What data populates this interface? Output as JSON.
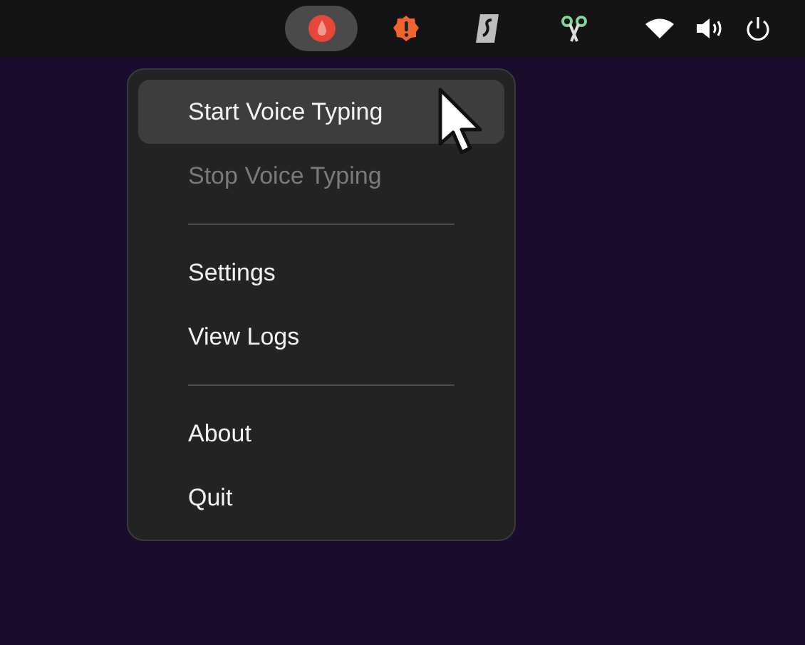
{
  "menu": [
    {
      "kind": "item",
      "label": "Start Voice Typing",
      "selected": true,
      "disabled": false
    },
    {
      "kind": "item",
      "label": "Stop Voice Typing",
      "selected": false,
      "disabled": true
    },
    {
      "kind": "separator"
    },
    {
      "kind": "item",
      "label": "Settings",
      "selected": false,
      "disabled": false
    },
    {
      "kind": "item",
      "label": "View Logs",
      "selected": false,
      "disabled": false
    },
    {
      "kind": "separator"
    },
    {
      "kind": "item",
      "label": "About",
      "selected": false,
      "disabled": false
    },
    {
      "kind": "item",
      "label": "Quit",
      "selected": false,
      "disabled": false
    }
  ]
}
